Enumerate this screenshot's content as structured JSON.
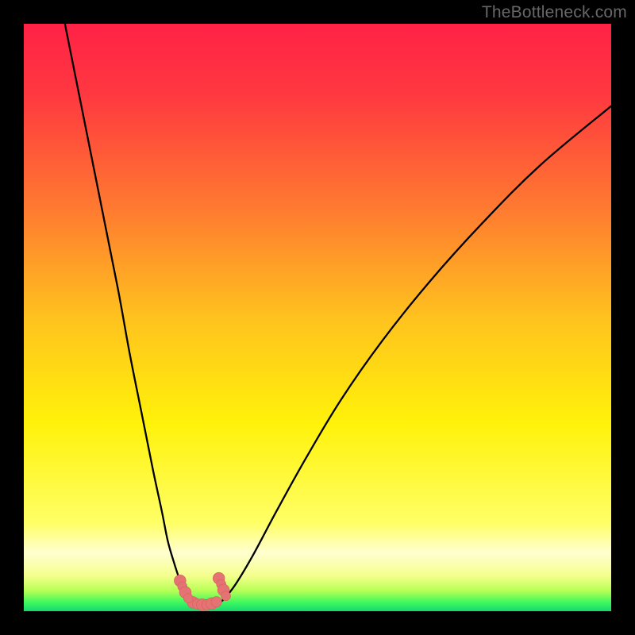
{
  "watermark": "TheBottleneck.com",
  "colors": {
    "frame": "#000000",
    "gradient_stops": [
      {
        "offset": 0.0,
        "color": "#ff2246"
      },
      {
        "offset": 0.12,
        "color": "#ff3840"
      },
      {
        "offset": 0.32,
        "color": "#ff7c30"
      },
      {
        "offset": 0.5,
        "color": "#ffc21e"
      },
      {
        "offset": 0.68,
        "color": "#fff20a"
      },
      {
        "offset": 0.85,
        "color": "#ffff66"
      },
      {
        "offset": 0.9,
        "color": "#ffffd0"
      },
      {
        "offset": 0.94,
        "color": "#f4ff8c"
      },
      {
        "offset": 0.965,
        "color": "#b8ff55"
      },
      {
        "offset": 0.985,
        "color": "#3ef95e"
      },
      {
        "offset": 1.0,
        "color": "#14d86f"
      }
    ],
    "curve": "#000000",
    "marker_fill": "#e57373",
    "marker_stroke": "#d45e5e"
  },
  "chart_data": {
    "type": "line",
    "title": "",
    "xlabel": "",
    "ylabel": "",
    "xlim": [
      0,
      100
    ],
    "ylim": [
      0,
      100
    ],
    "series": [
      {
        "name": "left-branch",
        "x": [
          7.0,
          10.0,
          13.0,
          16.0,
          18.0,
          20.0,
          22.0,
          23.5,
          24.5,
          25.5,
          26.3,
          27.0,
          27.7,
          28.3
        ],
        "y": [
          100.0,
          85.0,
          70.0,
          55.0,
          44.0,
          34.0,
          24.0,
          17.0,
          12.0,
          8.5,
          6.0,
          4.0,
          2.5,
          1.5
        ]
      },
      {
        "name": "trough",
        "x": [
          28.3,
          29.0,
          30.0,
          31.0,
          32.0,
          33.0,
          34.0
        ],
        "y": [
          1.5,
          1.0,
          0.8,
          0.8,
          0.9,
          1.3,
          2.0
        ]
      },
      {
        "name": "right-branch",
        "x": [
          34.0,
          36.0,
          39.0,
          43.0,
          48.0,
          54.0,
          61.0,
          69.0,
          78.0,
          88.0,
          100.0
        ],
        "y": [
          2.0,
          4.5,
          9.5,
          17.0,
          26.0,
          36.0,
          46.0,
          56.0,
          66.0,
          76.0,
          86.0
        ]
      }
    ],
    "markers_left": [
      {
        "x": 26.6,
        "y": 5.2,
        "r": 1.0
      },
      {
        "x": 27.0,
        "y": 4.2,
        "r": 0.8
      },
      {
        "x": 27.5,
        "y": 3.2,
        "r": 1.0
      },
      {
        "x": 28.0,
        "y": 2.2,
        "r": 0.8
      }
    ],
    "markers_right": [
      {
        "x": 33.2,
        "y": 5.6,
        "r": 1.0
      },
      {
        "x": 33.6,
        "y": 4.6,
        "r": 0.8
      },
      {
        "x": 34.0,
        "y": 3.6,
        "r": 1.0
      },
      {
        "x": 34.4,
        "y": 2.6,
        "r": 0.8
      }
    ],
    "markers_trough": [
      {
        "x": 28.8,
        "y": 1.5,
        "r": 1.0
      },
      {
        "x": 29.6,
        "y": 1.2,
        "r": 0.9
      },
      {
        "x": 30.4,
        "y": 1.1,
        "r": 1.0
      },
      {
        "x": 31.2,
        "y": 1.1,
        "r": 0.9
      },
      {
        "x": 32.0,
        "y": 1.3,
        "r": 1.0
      },
      {
        "x": 32.8,
        "y": 1.6,
        "r": 0.9
      }
    ]
  }
}
